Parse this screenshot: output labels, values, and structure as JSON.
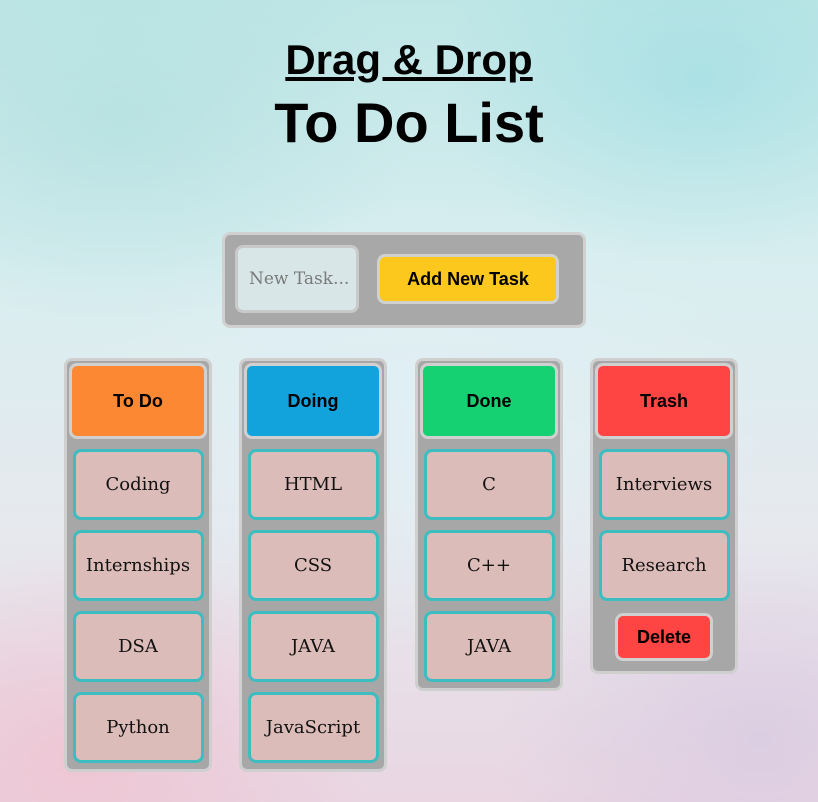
{
  "header": {
    "title_line1": "Drag & Drop",
    "title_line2": "To Do List"
  },
  "add_task": {
    "placeholder": "New Task...",
    "value": "",
    "button_label": "Add New Task",
    "button_color": "#fcc81e"
  },
  "columns": [
    {
      "title": "To Do",
      "color": "#fd8833",
      "cards": [
        "Coding",
        "Internships",
        "DSA",
        "Python"
      ]
    },
    {
      "title": "Doing",
      "color": "#12a3dc",
      "cards": [
        "HTML",
        "CSS",
        "JAVA",
        "JavaScript"
      ]
    },
    {
      "title": "Done",
      "color": "#15d172",
      "cards": [
        "C",
        "C++",
        "JAVA"
      ]
    },
    {
      "title": "Trash",
      "color": "#ff4444",
      "cards": [
        "Interviews",
        "Research"
      ],
      "delete_label": "Delete"
    }
  ],
  "colors": {
    "card_bg": "#dbbcb8",
    "card_border": "#3dbdc0",
    "panel_bg": "#a7a7a7"
  }
}
